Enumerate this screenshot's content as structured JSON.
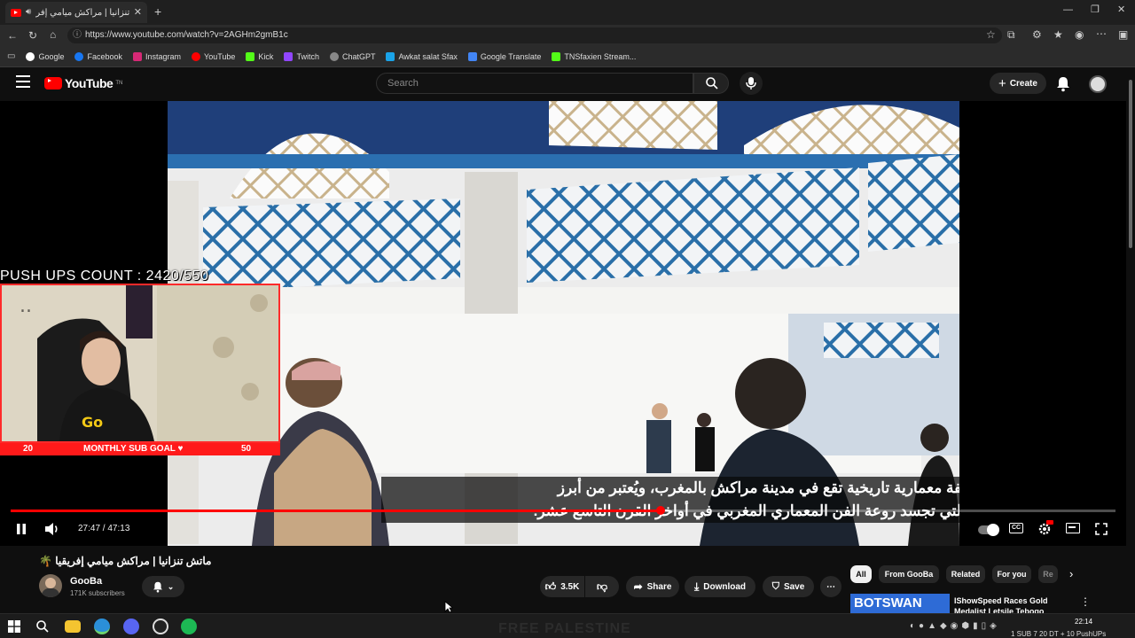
{
  "browser": {
    "tab_title": "ماتش تنزانيا | مراكش ميامي إفر",
    "url": "https://www.youtube.com/watch?v=2AGHm2gmB1c",
    "bookmarks": [
      "Google",
      "Facebook",
      "Instagram",
      "YouTube",
      "Kick",
      "Twitch",
      "ChatGPT",
      "Awkat salat Sfax",
      "Google Translate",
      "TNSfaxien Stream..."
    ]
  },
  "youtube_header": {
    "logo_text": "YouTube",
    "logo_sup": "TN",
    "search_placeholder": "Search",
    "create_label": "Create"
  },
  "player": {
    "subtitle_line1": "قصر الباهية هو تحفة معمارية تاريخية تقع في مدينة مراكش بالمغرب، ويُعتبر من أبرز",
    "subtitle_line2": "المعالم السياحية التي تجسد روعة الفن المعماري المغربي في أواخر القرن التاسع عشر.",
    "current_time": "27:47",
    "duration": "47:13",
    "progress_fraction": 0.588,
    "time_separator": " / "
  },
  "stream_overlay": {
    "pushups_label": "PUSH UPS COUNT : 2420/550",
    "subgoal_current": "20",
    "subgoal_label": "MONTHLY SUB GOAL ♥",
    "subgoal_target": "50"
  },
  "video_info": {
    "title": "ماتش تنزانيا | مراكش ميامي إفريقيا 🌴",
    "channel_name": "GooBa",
    "subscribers": "171K subscribers",
    "like_count": "3.5K",
    "share_label": "Share",
    "download_label": "Download",
    "save_label": "Save"
  },
  "chips": [
    "All",
    "From GooBa",
    "Related",
    "For you",
    "Re"
  ],
  "recommendation": {
    "title_line1": "IShowSpeed Races Gold",
    "title_line2": "Medalist Letsile Tebogo",
    "thumb_text": "BOTSWAN"
  },
  "taskbar": {
    "clock": "22:14",
    "ticker_text": "1 SUB 7 20 DT + 10 PushUPs",
    "bottom_banner": "FREE PALESTINE"
  },
  "colors": {
    "accent_red": "#ff0000",
    "bg": "#0f0f0f"
  }
}
